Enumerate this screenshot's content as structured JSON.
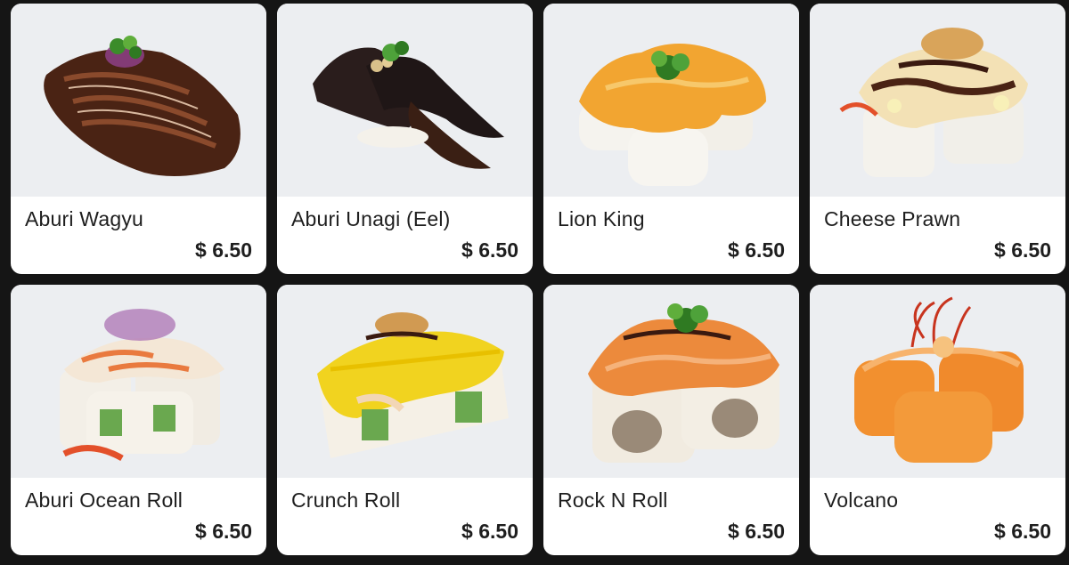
{
  "menu": {
    "items": [
      {
        "name": "Aburi Wagyu",
        "price": "$ 6.50",
        "image": "aburi-wagyu-photo"
      },
      {
        "name": "Aburi Unagi (Eel)",
        "price": "$ 6.50",
        "image": "aburi-unagi-photo"
      },
      {
        "name": "Lion King",
        "price": "$ 6.50",
        "image": "lion-king-photo"
      },
      {
        "name": "Cheese Prawn",
        "price": "$ 6.50",
        "image": "cheese-prawn-photo"
      },
      {
        "name": "Aburi Ocean Roll",
        "price": "$ 6.50",
        "image": "aburi-ocean-roll-photo"
      },
      {
        "name": "Crunch Roll",
        "price": "$ 6.50",
        "image": "crunch-roll-photo"
      },
      {
        "name": "Rock N Roll",
        "price": "$ 6.50",
        "image": "rock-n-roll-photo"
      },
      {
        "name": "Volcano",
        "price": "$ 6.50",
        "image": "volcano-photo"
      }
    ]
  },
  "colors": {
    "page_background": "#151515",
    "card_background": "#ffffff",
    "photo_background": "#eceef1",
    "text": "#1e1e1e"
  }
}
